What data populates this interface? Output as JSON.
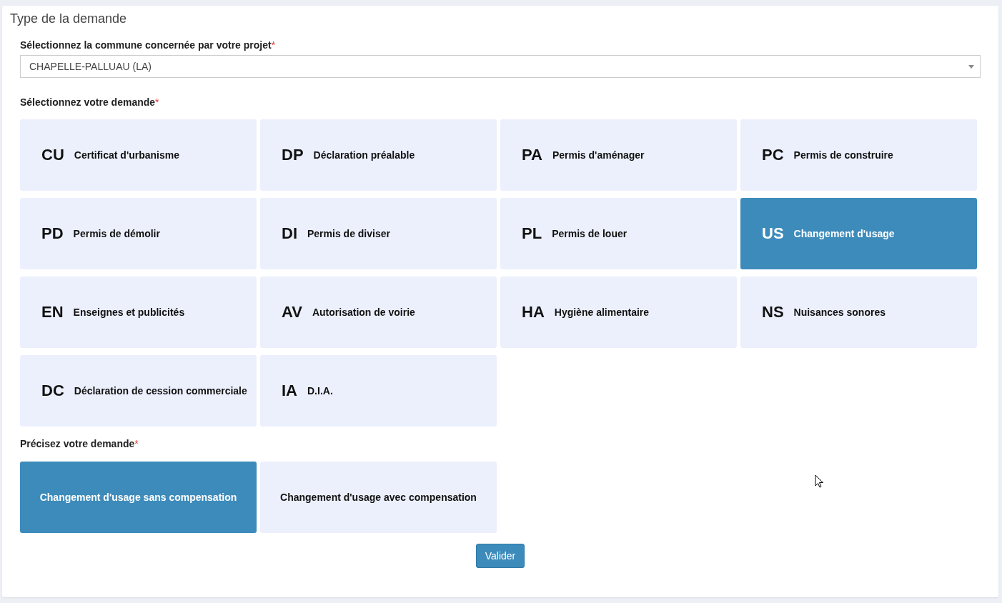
{
  "panel": {
    "title": "Type de la demande"
  },
  "commune": {
    "label": "Sélectionnez la commune concernée par votre projet",
    "required_mark": "*",
    "value": "CHAPELLE-PALLUAU (LA)"
  },
  "demande": {
    "label": "Sélectionnez votre demande",
    "required_mark": "*",
    "options": [
      {
        "code": "CU",
        "label": "Certificat d'urbanisme",
        "selected": false
      },
      {
        "code": "DP",
        "label": "Déclaration préalable",
        "selected": false
      },
      {
        "code": "PA",
        "label": "Permis d'aménager",
        "selected": false
      },
      {
        "code": "PC",
        "label": "Permis de construire",
        "selected": false
      },
      {
        "code": "PD",
        "label": "Permis de démolir",
        "selected": false
      },
      {
        "code": "DI",
        "label": "Permis de diviser",
        "selected": false
      },
      {
        "code": "PL",
        "label": "Permis de louer",
        "selected": false
      },
      {
        "code": "US",
        "label": "Changement d'usage",
        "selected": true
      },
      {
        "code": "EN",
        "label": "Enseignes et publicités",
        "selected": false
      },
      {
        "code": "AV",
        "label": "Autorisation de voirie",
        "selected": false
      },
      {
        "code": "HA",
        "label": "Hygiène alimentaire",
        "selected": false
      },
      {
        "code": "NS",
        "label": "Nuisances sonores",
        "selected": false
      },
      {
        "code": "DC",
        "label": "Déclaration de cession commerciale",
        "selected": false
      },
      {
        "code": "IA",
        "label": "D.I.A.",
        "selected": false
      }
    ]
  },
  "precision": {
    "label": "Précisez votre demande",
    "required_mark": "*",
    "options": [
      {
        "label": "Changement d'usage sans compensation",
        "selected": true
      },
      {
        "label": "Changement d'usage avec compensation",
        "selected": false
      }
    ]
  },
  "submit": {
    "label": "Valider"
  }
}
